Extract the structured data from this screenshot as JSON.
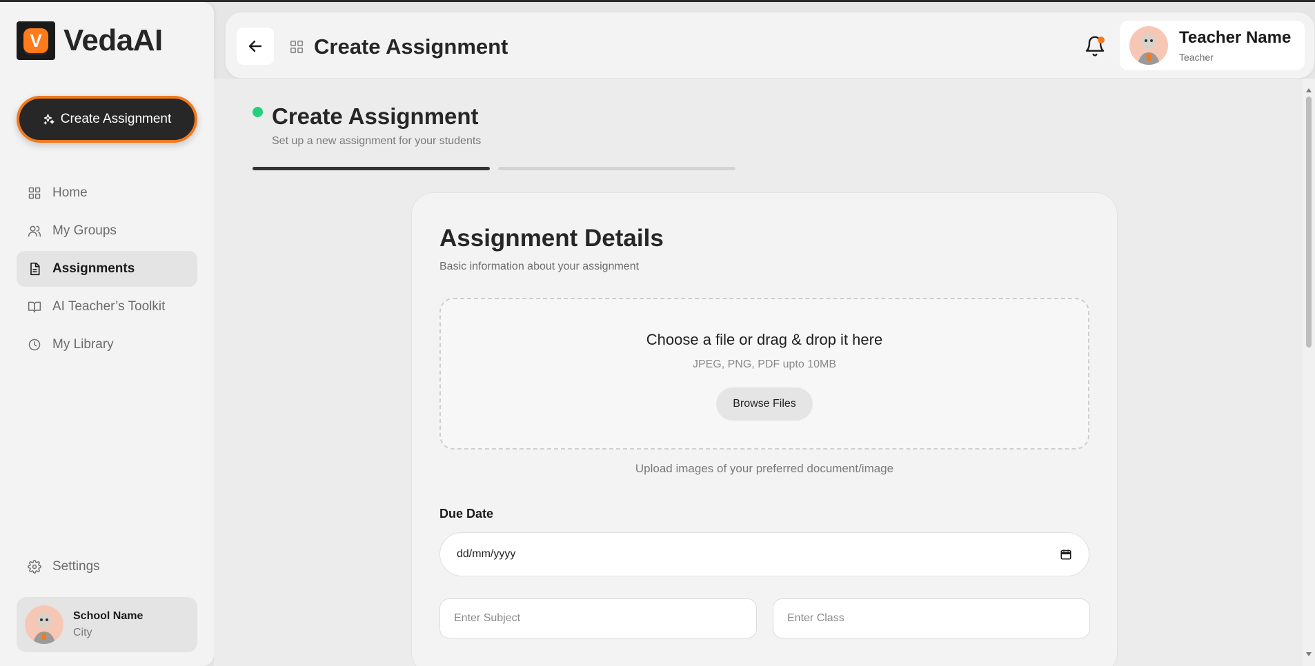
{
  "app": {
    "name": "VedaAI",
    "logo_letter": "V"
  },
  "sidebar": {
    "create_label": "Create Assignment",
    "items": [
      {
        "label": "Home",
        "icon": "grid-icon",
        "active": false
      },
      {
        "label": "My Groups",
        "icon": "users-icon",
        "active": false
      },
      {
        "label": "Assignments",
        "icon": "document-icon",
        "active": true
      },
      {
        "label": "AI Teacher’s Toolkit",
        "icon": "book-icon",
        "active": false
      },
      {
        "label": "My Library",
        "icon": "clock-icon",
        "active": false
      }
    ],
    "settings_label": "Settings",
    "school": {
      "name": "School Name",
      "city": "City"
    }
  },
  "header": {
    "title": "Create Assignment",
    "user": {
      "name": "Teacher Name",
      "role": "Teacher"
    }
  },
  "page": {
    "title": "Create Assignment",
    "subtitle": "Set up a new assignment for your students",
    "steps": {
      "current": 1,
      "total": 2
    }
  },
  "form": {
    "title": "Assignment Details",
    "subtitle": "Basic information about your assignment",
    "upload": {
      "title": "Choose a file or drag & drop it here",
      "hint": "JPEG, PNG, PDF upto 10MB",
      "browse_label": "Browse Files",
      "footer": "Upload images of your preferred document/image"
    },
    "due_date": {
      "label": "Due Date",
      "placeholder": "dd/mm/yyyy"
    },
    "subject_placeholder": "Enter Subject",
    "class_placeholder": "Enter Class"
  },
  "colors": {
    "accent": "#f07a1f",
    "status": "#22d17a",
    "dark": "#272727"
  }
}
